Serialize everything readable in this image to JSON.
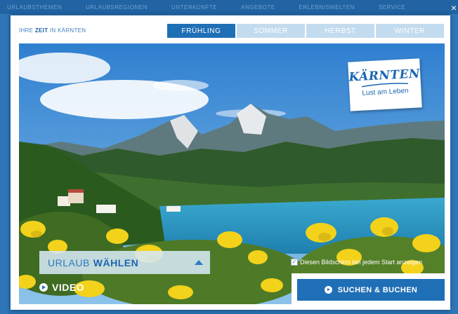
{
  "background": {
    "nav_items": [
      "URLAUBSTHEMEN",
      "URLAUBSREGIONEN",
      "UNTERKÜNFTE",
      "ANGEBOTE",
      "ERLEBNISWELTEN",
      "SERVICE"
    ]
  },
  "modal": {
    "brand_prefix": "IHRE ",
    "brand_bold": "ZEIT",
    "brand_suffix": " IN KÄRNTEN",
    "close_label": "×",
    "seasons": [
      {
        "label": "FRÜHLING",
        "active": true
      },
      {
        "label": "SOMMER",
        "active": false
      },
      {
        "label": "HERBST",
        "active": false
      },
      {
        "label": "WINTER",
        "active": false
      }
    ]
  },
  "logo": {
    "name": "KÄRNTEN",
    "tagline": "Lust am Leben"
  },
  "controls": {
    "select_light": "URLAUB",
    "select_bold": "WÄHLEN",
    "video_label": "VIDEO",
    "checkbox_label": "Diesen Bildschirm bei jedem Start anzeigen",
    "checkbox_checked": true,
    "search_label": "SUCHEN & BUCHEN"
  },
  "colors": {
    "accent": "#1f6fb6",
    "tab_inactive": "#c3dbee"
  }
}
